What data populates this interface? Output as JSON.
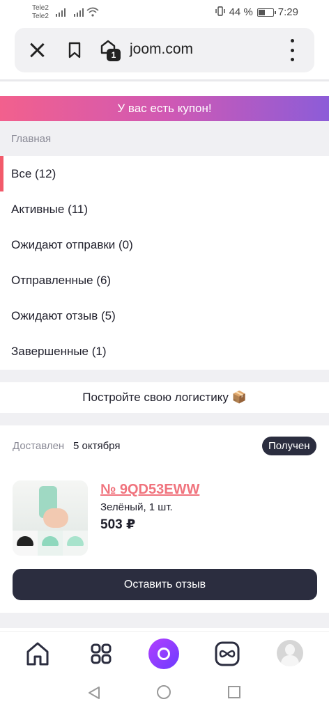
{
  "status_bar": {
    "carrier1": "Tele2",
    "carrier2": "Tele2",
    "battery_pct": "44 %",
    "battery_level": 0.44,
    "time": "7:29",
    "icons": [
      "signal-icon",
      "signal-icon",
      "wifi-icon",
      "vibrate-icon",
      "battery-icon"
    ]
  },
  "browser": {
    "url": "joom.com",
    "tab_count": "1",
    "icons": [
      "close-icon",
      "bookmark-icon",
      "tabs-icon",
      "more-vertical-icon"
    ]
  },
  "coupon_banner": "У вас есть купон!",
  "breadcrumb": "Главная",
  "filters": [
    {
      "label": "Все (12)",
      "active": true
    },
    {
      "label": "Активные (11)",
      "active": false
    },
    {
      "label": "Ожидают отправки (0)",
      "active": false
    },
    {
      "label": "Отправленные (6)",
      "active": false
    },
    {
      "label": "Ожидают отзыв (5)",
      "active": false
    },
    {
      "label": "Завершенные (1)",
      "active": false
    }
  ],
  "logistics_banner": "Постройте свою логистику 📦",
  "order": {
    "status_label": "Доставлен",
    "date": "5 октября",
    "badge": "Получен",
    "number": "№ 9QD53EWW",
    "variant": "Зелёный, 1 шт.",
    "price": "503 ₽",
    "review_button": "Оставить отзыв",
    "accent_color": "#f0737d"
  },
  "bottom_nav": {
    "items": [
      "home-icon",
      "catalog-icon",
      "alice-icon",
      "infinity-icon",
      "profile-avatar"
    ]
  },
  "colors": {
    "primary_dark": "#2b2d3f",
    "active_marker": "#f25a6a",
    "coupon_gradient": [
      "#f2608d",
      "#d159b3",
      "#8c5cd8"
    ]
  }
}
